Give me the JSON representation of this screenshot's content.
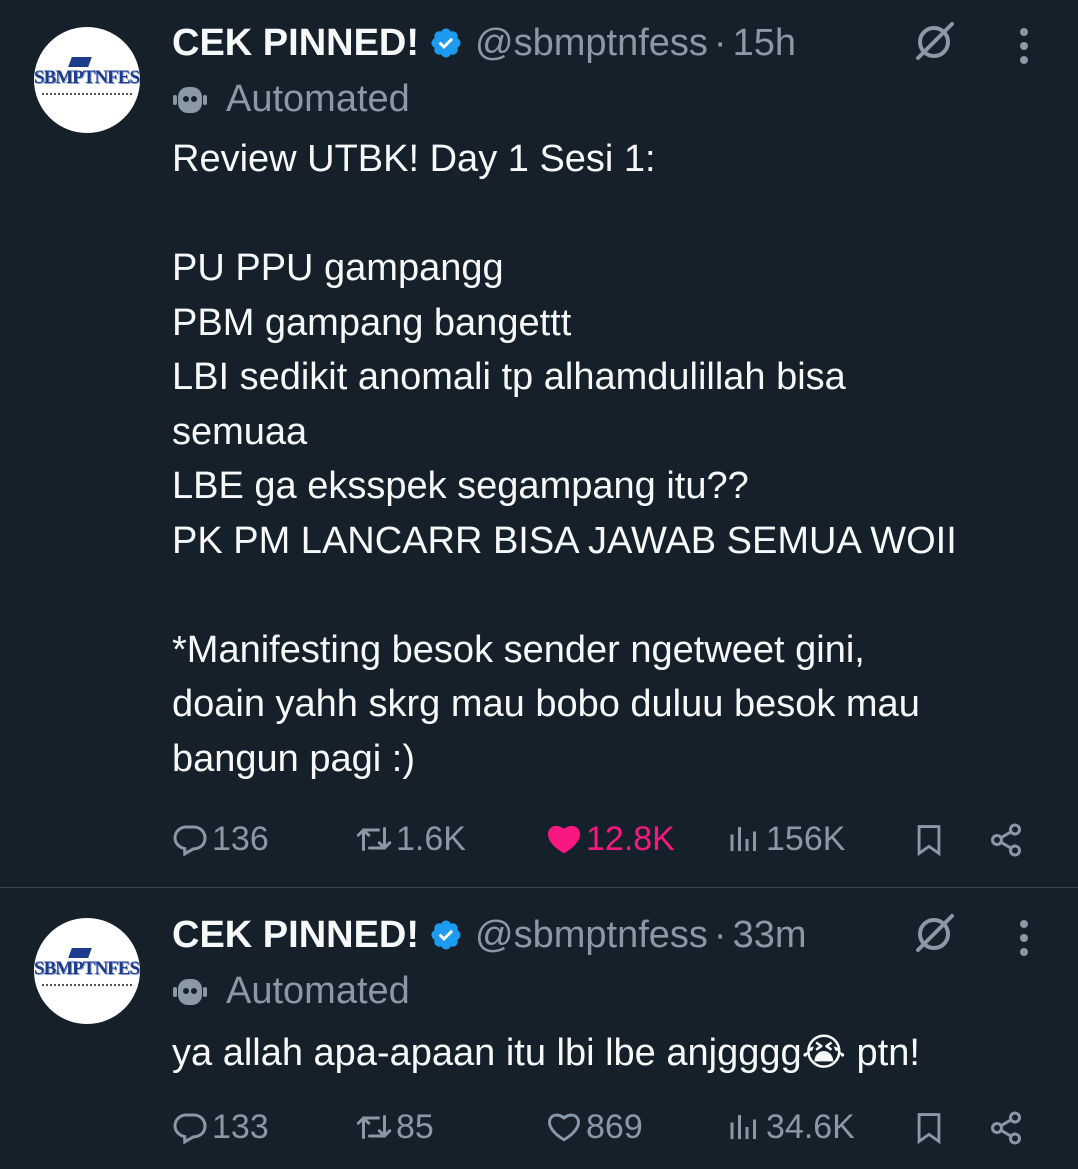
{
  "tweets": [
    {
      "name": "CEK PINNED!",
      "handle": "@sbmptnfess",
      "separator": "·",
      "time": "15h",
      "automated_label": "Automated",
      "avatar_text": "SBMPTNFESS",
      "text": "Review UTBK! Day 1 Sesi 1:\n\nPU PPU gampangg\nPBM gampang bangettt\nLBI sedikit anomali tp alhamdulillah bisa\nsemuaa\nLBE ga eksspek segampang itu??\nPK PM LANCARR BISA JAWAB SEMUA WOII\n\n*Manifesting besok sender ngetweet gini,\ndoain yahh skrg mau bobo duluu besok mau\nbangun pagi :)",
      "replies": "136",
      "retweets": "1.6K",
      "likes": "12.8K",
      "liked": true,
      "views": "156K"
    },
    {
      "name": "CEK PINNED!",
      "handle": "@sbmptnfess",
      "separator": "·",
      "time": "33m",
      "automated_label": "Automated",
      "avatar_text": "SBMPTNFESS",
      "text": "ya allah apa-apaan itu lbi lbe anjgggg😭 ptn!",
      "replies": "133",
      "retweets": "85",
      "likes": "869",
      "liked": false,
      "views": "34.6K"
    }
  ],
  "colors": {
    "background": "#15202b",
    "text": "#f7f9f9",
    "secondary": "#8b98a5",
    "verified": "#1d9bf0",
    "like": "#f91880",
    "divider": "#38444d"
  },
  "icons": [
    "verified-badge-icon",
    "grok-slash-icon",
    "more-icon",
    "bot-icon",
    "reply-icon",
    "retweet-icon",
    "like-icon",
    "views-icon",
    "bookmark-icon",
    "share-icon"
  ]
}
